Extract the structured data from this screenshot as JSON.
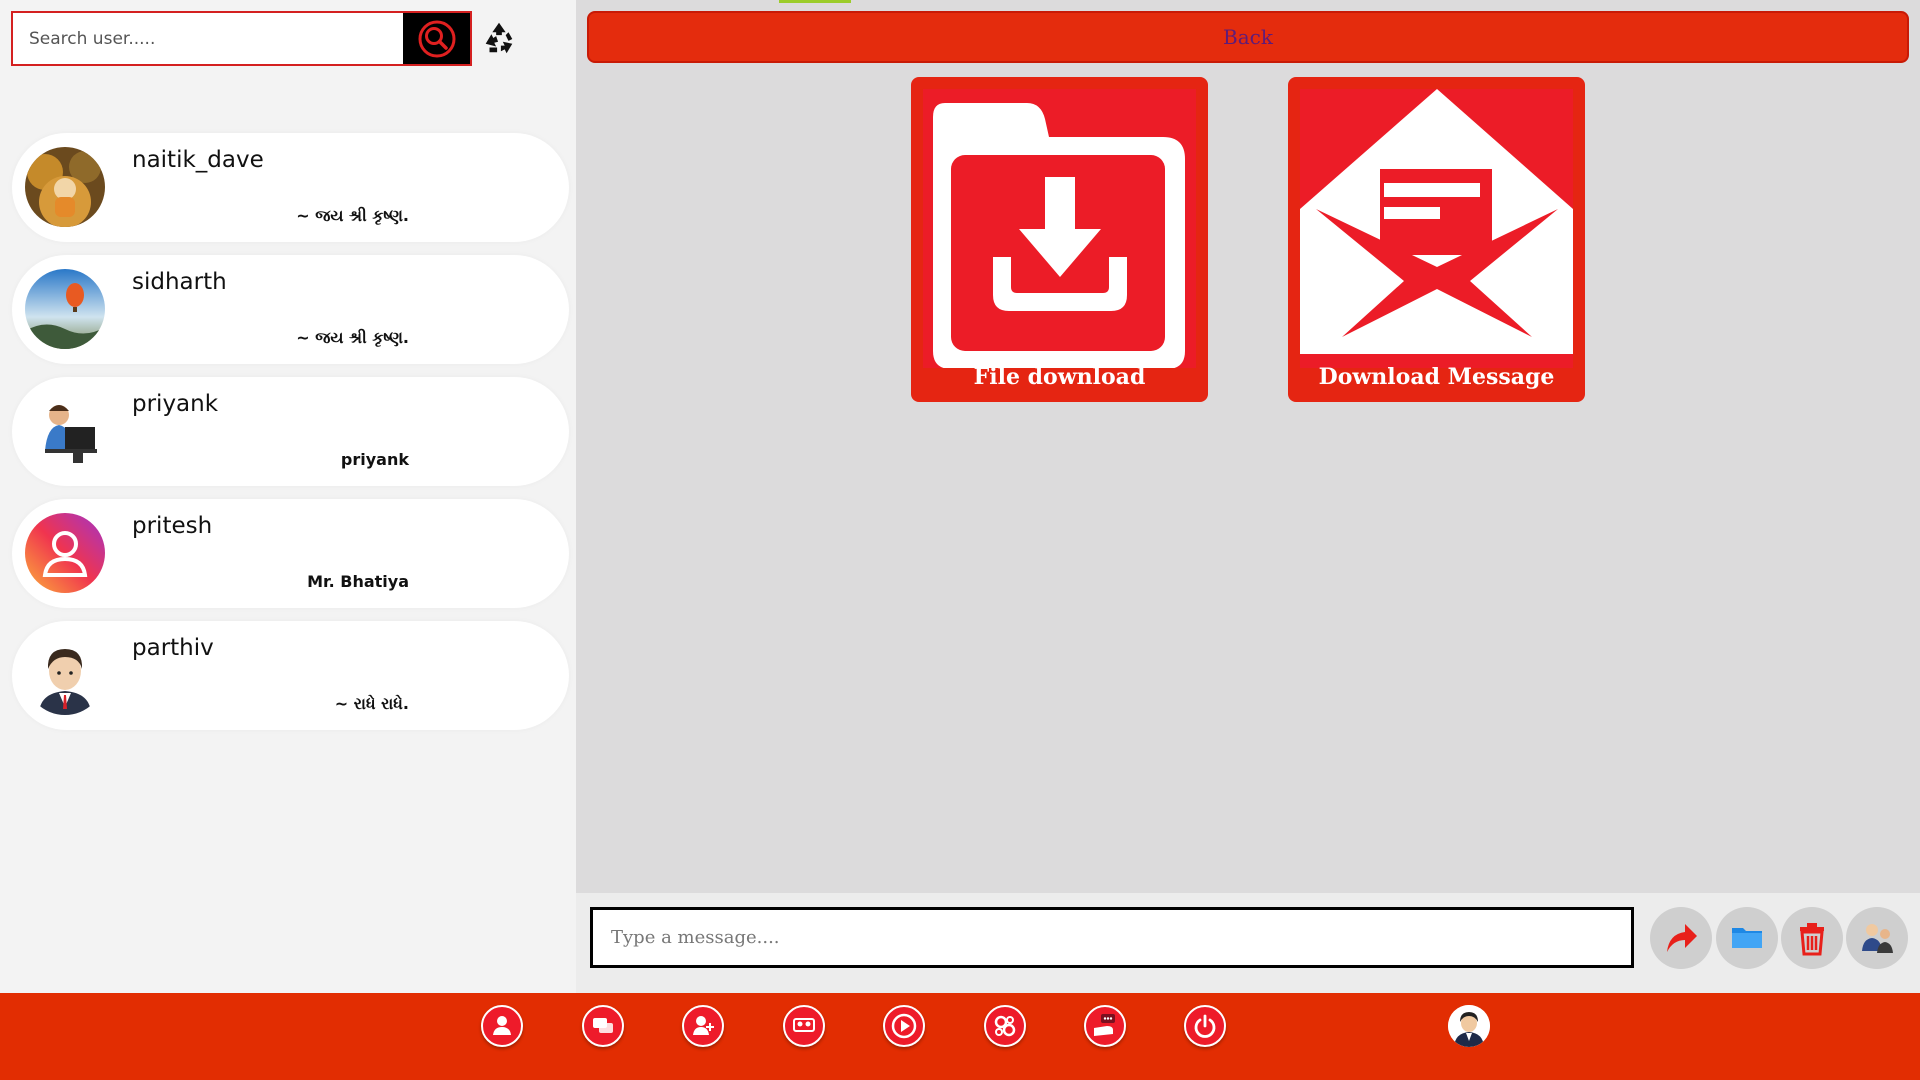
{
  "search": {
    "placeholder": "Search user....."
  },
  "users": [
    {
      "name": "naitik_dave",
      "status": "~ જય શ્રી કૃષ્ણ."
    },
    {
      "name": "sidharth",
      "status": "~ જય શ્રી કૃષ્ણ."
    },
    {
      "name": "priyank",
      "status": "priyank"
    },
    {
      "name": "pritesh",
      "status": "Mr. Bhatiya"
    },
    {
      "name": "parthiv",
      "status": "~ રાધે રાધે."
    }
  ],
  "main": {
    "back_label": "Back",
    "tiles": [
      {
        "label": "File download"
      },
      {
        "label": "Download Message"
      }
    ]
  },
  "composer": {
    "placeholder": "Type a message...."
  },
  "icons": {
    "search": "search-icon",
    "recycle": "recycle-icon",
    "send": "send-arrow-icon",
    "folder": "folder-icon",
    "trash": "trash-icon",
    "profile": "profile-icon",
    "nav": [
      "user-icon",
      "chat-icon",
      "add-user-icon",
      "group-icon",
      "video-play-icon",
      "settings-icon",
      "feedback-icon",
      "power-icon"
    ]
  },
  "colors": {
    "accent": "#e22d02",
    "tile": "#ec1c27",
    "back_text": "#5e1c7a"
  }
}
